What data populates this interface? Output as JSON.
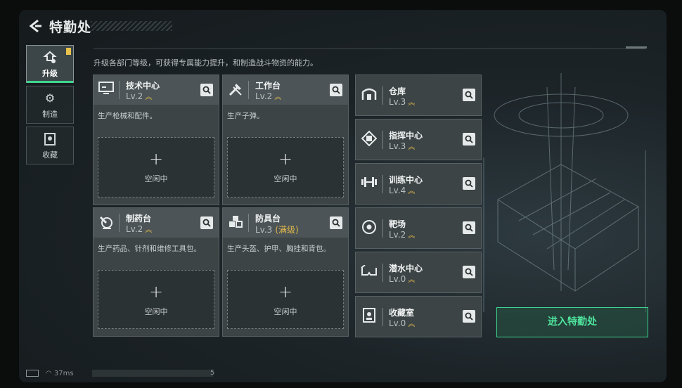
{
  "header": {
    "title": "特勤处"
  },
  "hint": "升级各部门等级，可获得专属能力提升，和制造战斗物资的能力。",
  "sidebar": {
    "items": [
      {
        "label": "升级",
        "active": true,
        "icon": "upgrade-icon"
      },
      {
        "label": "制造",
        "active": false,
        "icon": "gears-icon"
      },
      {
        "label": "收藏",
        "active": false,
        "icon": "collection-icon"
      }
    ]
  },
  "cards": [
    {
      "name": "技术中心",
      "level": "Lv.2",
      "desc": "生产枪械和配件。",
      "slot_text": "空闲中",
      "icon": "tech-center-icon"
    },
    {
      "name": "工作台",
      "level": "Lv.2",
      "desc": "生产子弹。",
      "slot_text": "空闲中",
      "icon": "workbench-icon"
    },
    {
      "name": "制药台",
      "level": "Lv.2",
      "desc": "生产药品、针剂和维修工具包。",
      "slot_text": "空闲中",
      "icon": "pharmacy-icon"
    },
    {
      "name": "防具台",
      "level": "Lv.3",
      "max": "(满级)",
      "desc": "生产头盔、护甲、胸挂和背包。",
      "slot_text": "空闲中",
      "icon": "armor-bench-icon"
    }
  ],
  "right_cards": [
    {
      "name": "仓库",
      "level": "Lv.3",
      "icon": "warehouse-icon"
    },
    {
      "name": "指挥中心",
      "level": "Lv.3",
      "icon": "command-center-icon"
    },
    {
      "name": "训练中心",
      "level": "Lv.4",
      "icon": "training-center-icon"
    },
    {
      "name": "靶场",
      "level": "Lv.2",
      "icon": "shooting-range-icon"
    },
    {
      "name": "潜水中心",
      "level": "Lv.0",
      "icon": "diving-center-icon"
    },
    {
      "name": "收藏室",
      "level": "Lv.0",
      "icon": "collection-room-icon"
    }
  ],
  "enter_button": "进入特勤处",
  "status": {
    "ping": "37ms",
    "page": "5"
  },
  "colors": {
    "accent": "#3cd48e",
    "level_arrow": "#e0b84a",
    "badge": "#e8c24a"
  }
}
